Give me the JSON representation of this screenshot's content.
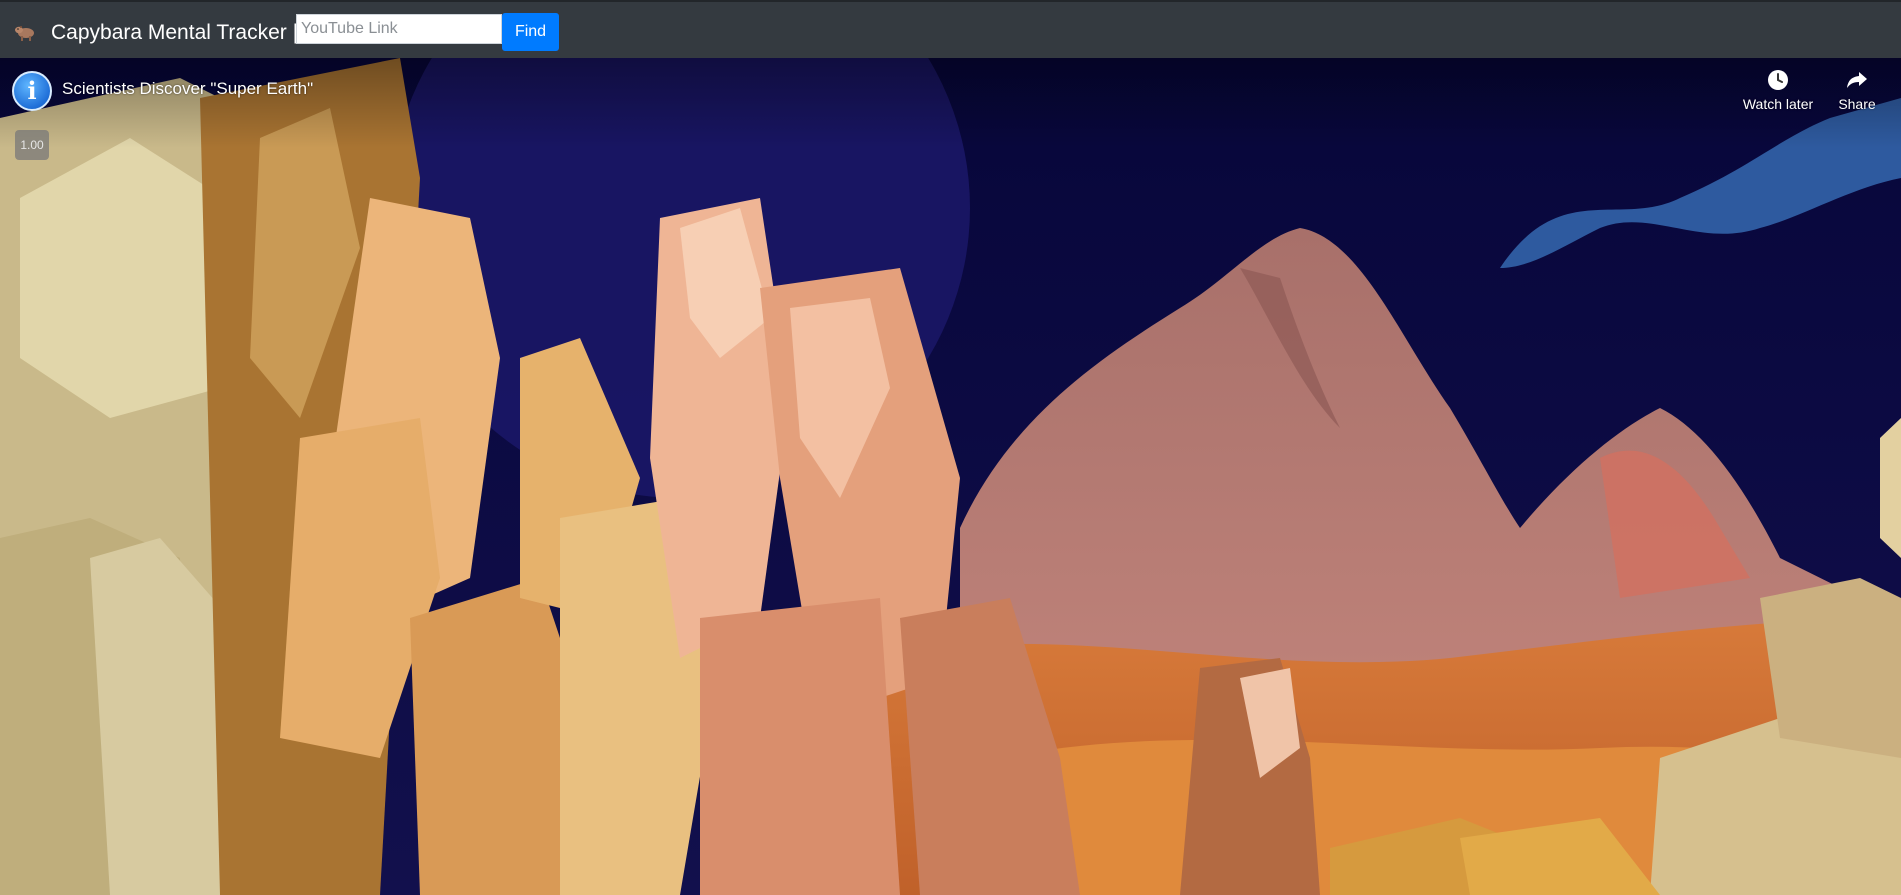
{
  "navbar": {
    "brand_title": "Capybara Mental Tracker |",
    "search_placeholder": "YouTube Link",
    "search_value": "",
    "find_label": "Find",
    "logo_icon": "capybara-icon"
  },
  "player": {
    "channel_avatar_glyph": "i",
    "video_title": "Scientists Discover \"Super Earth\"",
    "playback_speed": "1.00",
    "watch_later_label": "Watch later",
    "share_label": "Share",
    "icons": {
      "watch_later": "clock-icon",
      "share": "share-arrow-icon"
    }
  },
  "colors": {
    "navbar_bg": "#343a40",
    "find_button_bg": "#007bff",
    "sky": "#0b0a3d"
  }
}
